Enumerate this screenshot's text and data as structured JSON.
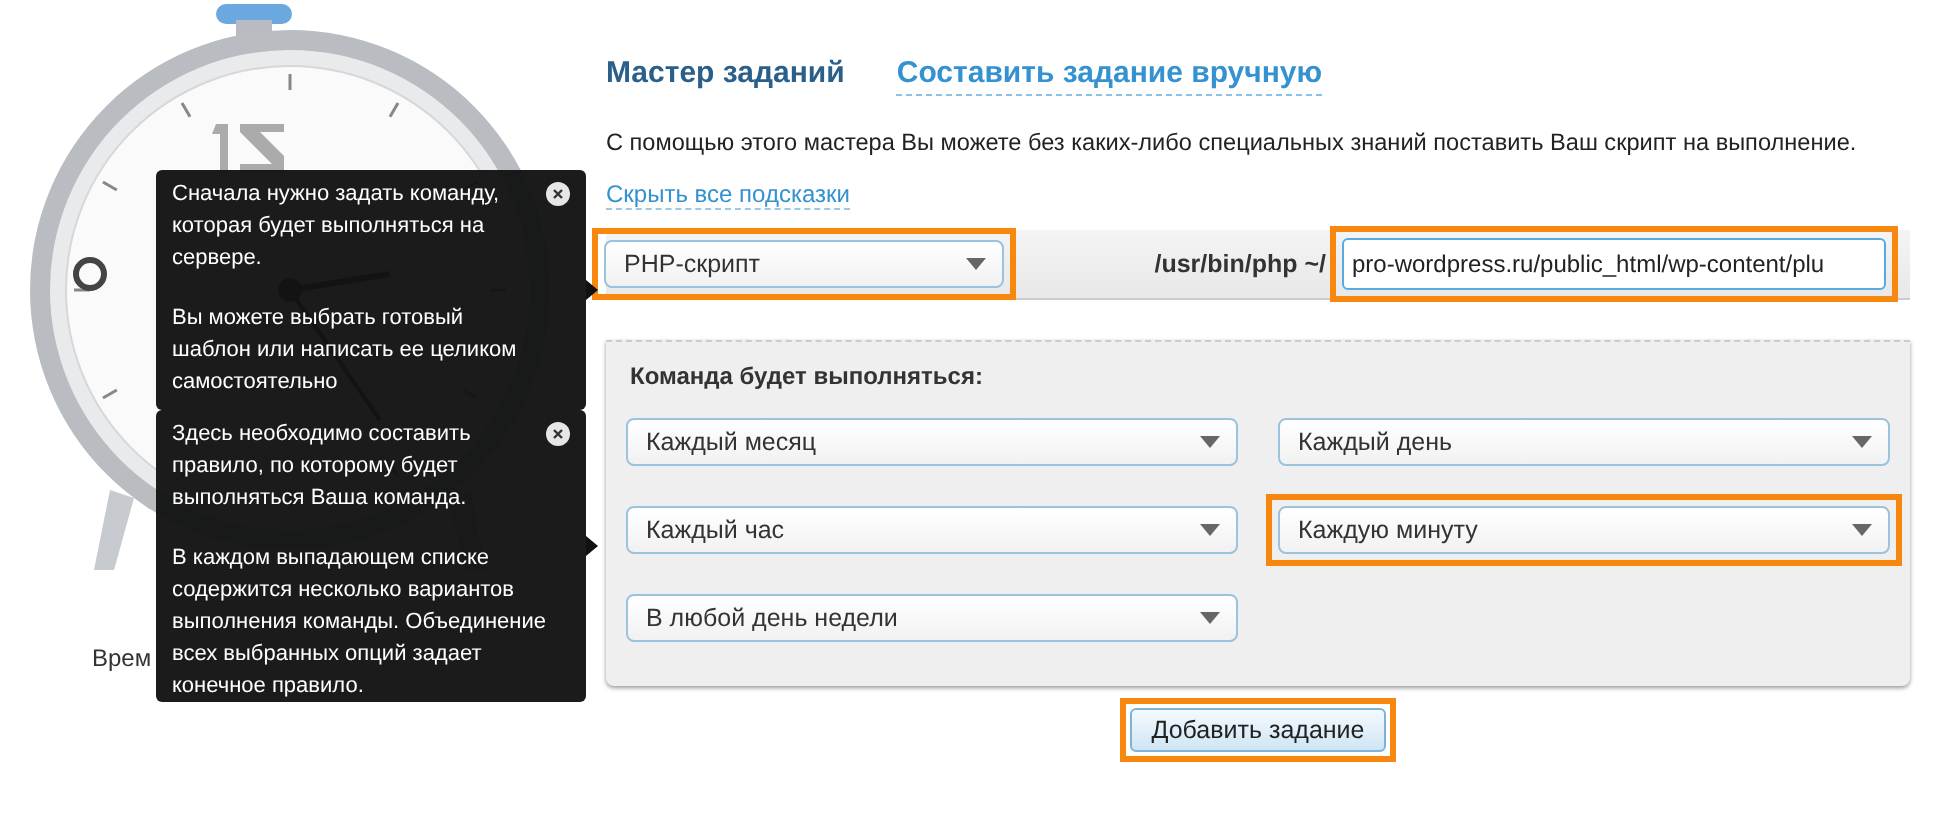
{
  "clock": {
    "time_label": "Врем"
  },
  "tooltips": [
    {
      "paragraphs": [
        "Сначала нужно задать команду, которая будет выполняться на сервере.",
        "Вы можете выбрать готовый шаблон или написать ее целиком самостоятельно"
      ]
    },
    {
      "paragraphs": [
        "Здесь необходимо составить правило, по которому будет выполняться Ваша команда.",
        "В каждом выпадающем списке содержится несколько вариантов выполнения команды. Объединение всех выбранных опций задает конечное правило."
      ]
    }
  ],
  "tabs": [
    {
      "label": "Мастер заданий",
      "selected": true
    },
    {
      "label": "Составить задание вручную",
      "selected": false
    }
  ],
  "description": "С помощью этого мастера Вы можете без каких-либо специальных знаний поставить Ваш скрипт на выполнение.",
  "hide_hints_link": "Скрыть все подсказки",
  "command": {
    "type_select": {
      "value": "PHP-скрипт",
      "highlighted": true
    },
    "path_prefix": "/usr/bin/php ~/",
    "path_input": {
      "value": "pro-wordpress.ru/public_html/wp-content/plu",
      "highlighted": true
    }
  },
  "schedule": {
    "heading": "Команда будет выполняться:",
    "selects": [
      {
        "value": "Каждый месяц",
        "highlighted": false
      },
      {
        "value": "Каждый день",
        "highlighted": false
      },
      {
        "value": "Каждый час",
        "highlighted": false
      },
      {
        "value": "Каждую минуту",
        "highlighted": true
      },
      {
        "value": "В любой день недели",
        "highlighted": false
      }
    ]
  },
  "submit": {
    "label": "Добавить задание",
    "highlighted": true
  }
}
